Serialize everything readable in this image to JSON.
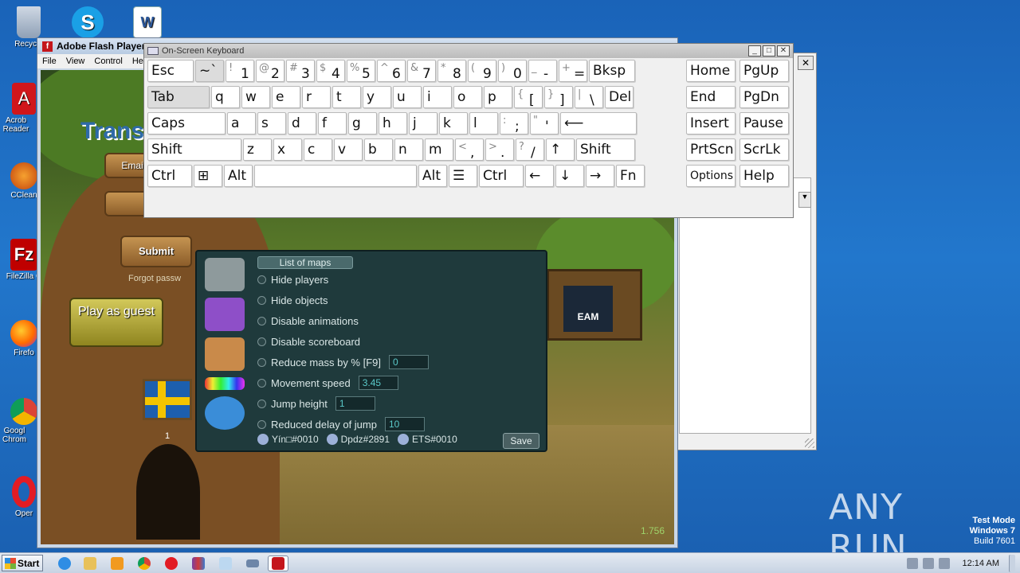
{
  "desktop": {
    "icons": [
      {
        "label": "Recycle",
        "icon": "recycle-bin-icon"
      },
      {
        "label": "",
        "icon": "skype-icon"
      },
      {
        "label": "",
        "icon": "word-document-icon"
      },
      {
        "label": "Acrob Reader",
        "icon": "acrobat-icon"
      },
      {
        "label": "CClean",
        "icon": "ccleaner-icon"
      },
      {
        "label": "FileZilla C",
        "icon": "filezilla-icon"
      },
      {
        "label": "Firefo",
        "icon": "firefox-icon"
      },
      {
        "label": "Googl Chrom",
        "icon": "chrome-icon"
      },
      {
        "label": "Oper",
        "icon": "opera-icon"
      }
    ],
    "watermark": "ANY RUN",
    "test_mode": {
      "line1": "Test Mode",
      "line2": "Windows 7",
      "line3": "Build 7601"
    }
  },
  "flash_window": {
    "title": "Adobe Flash Player",
    "menu": [
      "File",
      "View",
      "Control",
      "Hel"
    ]
  },
  "game": {
    "logo": "Trans",
    "email_label": "Emai",
    "submit": "Submit",
    "forgot": "Forgot passw",
    "play_guest": "Play as guest",
    "flag_number": "1",
    "steam": "EAM",
    "fps": "1.756"
  },
  "mod_menu": {
    "tab": "List of maps",
    "options": [
      {
        "label": "Hide players",
        "value": null
      },
      {
        "label": "Hide objects",
        "value": null
      },
      {
        "label": "Disable animations",
        "value": null
      },
      {
        "label": "Disable scoreboard",
        "value": null
      },
      {
        "label": "Reduce mass by % [F9]",
        "value": "0"
      },
      {
        "label": "Movement speed",
        "value": "3.45"
      },
      {
        "label": "Jump height",
        "value": "1"
      },
      {
        "label": "Reduced delay of jump",
        "value": "10"
      }
    ],
    "credits": [
      "Yín□#0010",
      "Dpdz#2891",
      "ETS#0010"
    ],
    "save": "Save"
  },
  "osk": {
    "title": "On-Screen Keyboard",
    "rows": [
      [
        {
          "m": "Esc",
          "w": 60
        },
        {
          "m": "~`",
          "w": 38,
          "dim": true
        },
        {
          "s": "!",
          "m": "1",
          "w": 38
        },
        {
          "s": "@",
          "m": "2",
          "w": 38
        },
        {
          "s": "#",
          "m": "3",
          "w": 38
        },
        {
          "s": "$",
          "m": "4",
          "w": 38
        },
        {
          "s": "%",
          "m": "5",
          "w": 38
        },
        {
          "s": "^",
          "m": "6",
          "w": 38
        },
        {
          "s": "&",
          "m": "7",
          "w": 38
        },
        {
          "s": "*",
          "m": "8",
          "w": 38
        },
        {
          "s": "(",
          "m": "9",
          "w": 38
        },
        {
          "s": ")",
          "m": "0",
          "w": 38
        },
        {
          "s": "_",
          "m": "-",
          "w": 38
        },
        {
          "s": "+",
          "m": "=",
          "w": 38
        },
        {
          "m": "Bksp",
          "w": 60
        }
      ],
      [
        {
          "m": "Tab",
          "w": 80,
          "dim": true
        },
        {
          "m": "q",
          "w": 38
        },
        {
          "m": "w",
          "w": 38
        },
        {
          "m": "e",
          "w": 38
        },
        {
          "m": "r",
          "w": 38
        },
        {
          "m": "t",
          "w": 38
        },
        {
          "m": "y",
          "w": 38
        },
        {
          "m": "u",
          "w": 38
        },
        {
          "m": "i",
          "w": 38
        },
        {
          "m": "o",
          "w": 38
        },
        {
          "m": "p",
          "w": 38
        },
        {
          "s": "{",
          "m": "[",
          "w": 38
        },
        {
          "s": "}",
          "m": "]",
          "w": 38
        },
        {
          "s": "|",
          "m": "\\",
          "w": 38
        },
        {
          "m": "Del",
          "w": 38
        }
      ],
      [
        {
          "m": "Caps",
          "w": 100
        },
        {
          "m": "a",
          "w": 38
        },
        {
          "m": "s",
          "w": 38
        },
        {
          "m": "d",
          "w": 38
        },
        {
          "m": "f",
          "w": 38
        },
        {
          "m": "g",
          "w": 38
        },
        {
          "m": "h",
          "w": 38
        },
        {
          "m": "j",
          "w": 38
        },
        {
          "m": "k",
          "w": 38
        },
        {
          "m": "l",
          "w": 38
        },
        {
          "s": ":",
          "m": ";",
          "w": 38
        },
        {
          "s": "\"",
          "m": "'",
          "w": 38
        },
        {
          "m": "⟵",
          "w": 98
        }
      ],
      [
        {
          "m": "Shift",
          "w": 120
        },
        {
          "m": "z",
          "w": 38
        },
        {
          "m": "x",
          "w": 38
        },
        {
          "m": "c",
          "w": 38
        },
        {
          "m": "v",
          "w": 38
        },
        {
          "m": "b",
          "w": 38
        },
        {
          "m": "n",
          "w": 38
        },
        {
          "m": "m",
          "w": 38
        },
        {
          "s": "<",
          "m": ",",
          "w": 38
        },
        {
          "s": ">",
          "m": ".",
          "w": 38
        },
        {
          "s": "?",
          "m": "/",
          "w": 38
        },
        {
          "m": "↑",
          "w": 38
        },
        {
          "m": "Shift",
          "w": 76
        }
      ],
      [
        {
          "m": "Ctrl",
          "w": 58
        },
        {
          "m": "⊞",
          "w": 38
        },
        {
          "m": "Alt",
          "w": 38
        },
        {
          "m": "",
          "w": 206
        },
        {
          "m": "Alt",
          "w": 38
        },
        {
          "m": "☰",
          "w": 38
        },
        {
          "m": "Ctrl",
          "w": 58
        },
        {
          "m": "←",
          "w": 38
        },
        {
          "m": "↓",
          "w": 38
        },
        {
          "m": "→",
          "w": 38
        },
        {
          "m": "Fn",
          "w": 38
        }
      ]
    ],
    "nav": [
      [
        "Home",
        "PgUp"
      ],
      [
        "End",
        "PgDn"
      ],
      [
        "Insert",
        "Pause"
      ],
      [
        "PrtScn",
        "ScrLk"
      ],
      [
        "Options",
        "Help"
      ]
    ]
  },
  "taskbar": {
    "start": "Start",
    "clock": "12:14 AM",
    "items": [
      "ie-icon",
      "explorer-icon",
      "media-player-icon",
      "chrome-icon",
      "opera-icon",
      "winrar-icon",
      "notepad-icon",
      "osk-icon",
      "flash-player-icon"
    ]
  }
}
